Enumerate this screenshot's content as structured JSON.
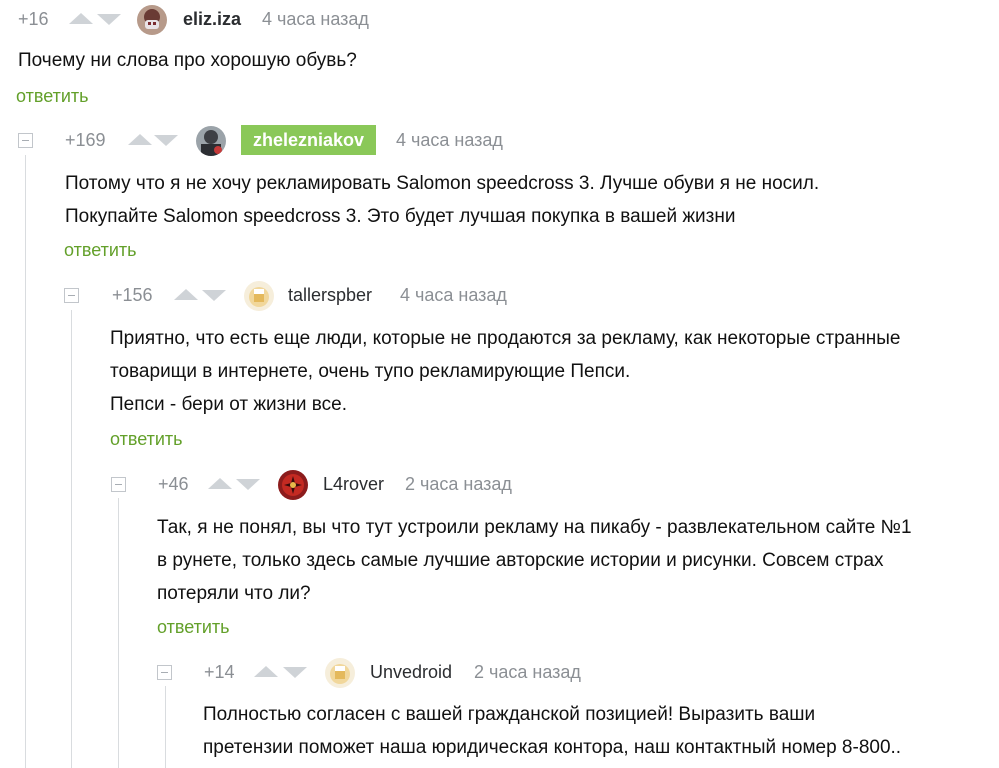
{
  "comments": [
    {
      "rating": "+16",
      "username": "eliz.iza",
      "time": "4 часа назад",
      "text": [
        "Почему ни слова про хорошую обувь?"
      ],
      "reply_label": "ответить",
      "has_collapse": false,
      "user_highlight": false
    },
    {
      "rating": "+169",
      "username": "zhelezniakov",
      "time": "4 часа назад",
      "text": [
        "Потому что я не хочу рекламировать Salomon speedcross 3. Лучше обуви я не носил.",
        "Покупайте Salomon speedcross 3. Это будет лучшая покупка в вашей жизни"
      ],
      "reply_label": "ответить",
      "has_collapse": true,
      "user_highlight": true,
      "highlight_color": "#8ac858"
    },
    {
      "rating": "+156",
      "username": "tallerspber",
      "time": "4 часа назад",
      "text": [
        "Приятно, что есть еще люди, которые не продаются за рекламу, как некоторые странные",
        "товарищи в интернете, очень тупо рекламирующие Пепси.",
        "Пепси - бери от жизни все."
      ],
      "reply_label": "ответить",
      "has_collapse": true,
      "user_highlight": false
    },
    {
      "rating": "+46",
      "username": "L4rover",
      "time": "2 часа назад",
      "text": [
        "Так, я не понял, вы что тут устроили рекламу на пикабу - развлекательном сайте №1",
        "в рунете, только здесь самые лучшие авторские истории и рисунки. Совсем страх",
        "потеряли что ли?"
      ],
      "reply_label": "ответить",
      "has_collapse": true,
      "user_highlight": false
    },
    {
      "rating": "+14",
      "username": "Unvedroid",
      "time": "2 часа назад",
      "text": [
        "Полностью согласен с вашей гражданской позицией! Выразить ваши",
        "претензии поможет наша юридическая контора, наш контактный номер 8-800.."
      ],
      "reply_label": "",
      "has_collapse": true,
      "user_highlight": false
    }
  ],
  "colors": {
    "accent_green": "#63a02a",
    "tag_green": "#8ac858",
    "muted": "#8b8f94",
    "vote_arrow": "#cfd3d7"
  }
}
